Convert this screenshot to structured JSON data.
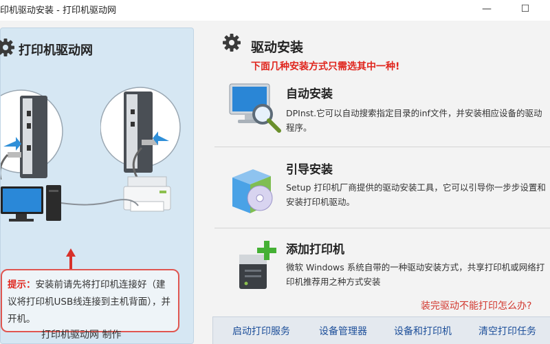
{
  "window": {
    "title": "印机驱动安装 - 打印机驱动网",
    "minimize_glyph": "—",
    "maximize_glyph": "☐"
  },
  "left": {
    "title": "打印机驱动网",
    "tip_label": "提示：",
    "tip_text": "安装前请先将打印机连接好（建议将打印机USB线连接到主机背面），并开机。",
    "footer": "打印机驱动网  制作"
  },
  "right": {
    "title": "驱动安装",
    "subtitle": "下面几种安装方式只需选其中一种!",
    "options": [
      {
        "icon": "monitor-search-icon",
        "title": "自动安装",
        "desc": "DPInst.它可以自动搜索指定目录的inf文件，并安装相应设备的驱动程序。"
      },
      {
        "icon": "installer-box-icon",
        "title": "引导安装",
        "desc": "Setup 打印机厂商提供的驱动安装工具，它可以引导你一步步设置和安装打印机驱动。"
      },
      {
        "icon": "add-printer-icon",
        "title": "添加打印机",
        "desc": "微软 Windows 系统自带的一种驱动安装方式，共享打印机或网络打印机推荐用之种方式安装"
      }
    ],
    "help_link": "装完驱动不能打印怎么办?"
  },
  "actions": [
    "启动打印服务",
    "设备管理器",
    "设备和打印机",
    "清空打印任务"
  ],
  "colors": {
    "accent_red": "#e0251d",
    "link_blue": "#1d4f9a",
    "panel_blue": "#d6e7f3"
  }
}
